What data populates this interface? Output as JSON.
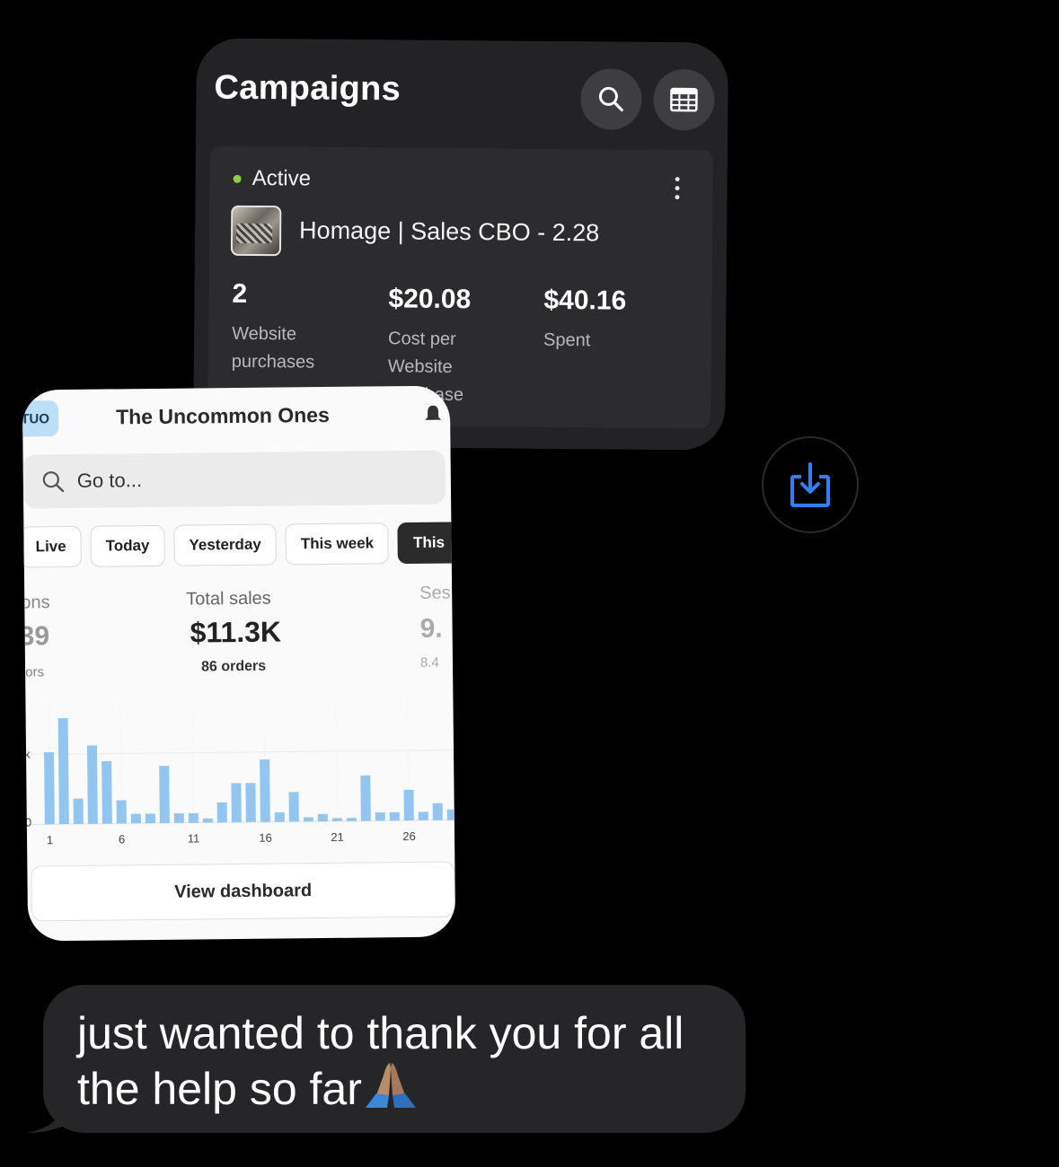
{
  "campaigns": {
    "title": "Campaigns",
    "status": "Active",
    "status_color": "#8fce3f",
    "campaign_name": "Homage | Sales CBO - 2.28",
    "metrics": [
      {
        "value": "2",
        "label": "Website purchases"
      },
      {
        "value": "$20.08",
        "label": "Cost per Website Purchase"
      },
      {
        "value": "$40.16",
        "label": "Spent"
      }
    ],
    "icons": [
      "search-icon",
      "table-icon",
      "more-vertical-icon"
    ]
  },
  "store": {
    "badge": "TUO",
    "title": "The Uncommon Ones",
    "search_placeholder": "Go to...",
    "tabs": [
      "Live",
      "Today",
      "Yesterday",
      "This week",
      "This"
    ],
    "active_tab": "This",
    "left_stat": {
      "label": "ons",
      "value": "39",
      "sub": "tors"
    },
    "total_sales": {
      "label": "Total sales",
      "value": "$11.3K",
      "sub": "86 orders"
    },
    "right_stat": {
      "label": "Ses",
      "value": "9.",
      "sub": "8.4"
    },
    "view_dashboard": "View dashboard",
    "accent": "#92c6f0"
  },
  "chart_data": {
    "type": "bar",
    "x": [
      1,
      2,
      3,
      4,
      5,
      6,
      7,
      8,
      9,
      10,
      11,
      12,
      13,
      14,
      15,
      16,
      17,
      18,
      19,
      20,
      21,
      22,
      23,
      24,
      25,
      26,
      27,
      28,
      29
    ],
    "values": [
      0.68,
      1.0,
      0.24,
      0.74,
      0.59,
      0.22,
      0.09,
      0.09,
      0.54,
      0.09,
      0.09,
      0.04,
      0.19,
      0.37,
      0.37,
      0.59,
      0.09,
      0.28,
      0.04,
      0.07,
      0.03,
      0.03,
      0.43,
      0.08,
      0.08,
      0.29,
      0.08,
      0.16,
      0.1
    ],
    "xticks": [
      "1",
      "6",
      "11",
      "16",
      "21",
      "26"
    ],
    "ytick_labels": [
      "k",
      "0"
    ],
    "grid": true
  },
  "share_icon": "share-download-icon",
  "message": {
    "text": "just wanted to thank you for all the help so far",
    "emoji": "folded-hands-icon"
  }
}
